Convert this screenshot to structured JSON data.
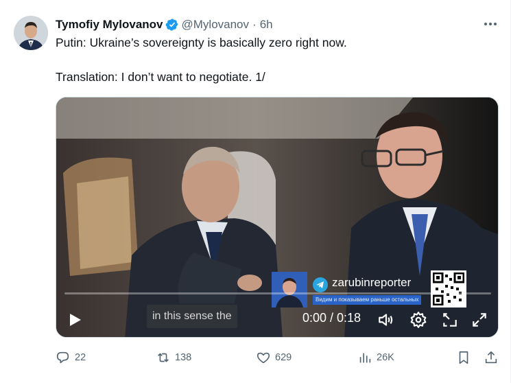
{
  "author": {
    "display_name": "Tymofiy Mylovanov",
    "handle": "@Mylovanov",
    "separator": "·",
    "time": "6h"
  },
  "tweet": {
    "line1": "Putin: Ukraine’s sovereignty is basically zero right now.",
    "line2": "Translation: I don’t want to negotiate. 1/"
  },
  "video": {
    "subtitle": "in this sense the",
    "watermark_channel": "zarubinreporter",
    "watermark_tagline": "Видим и показываем раньше остальных",
    "time": "0:00 / 0:18",
    "progress": 0
  },
  "actions": {
    "replies": "22",
    "reposts": "138",
    "likes": "629",
    "views": "26K"
  },
  "icons": {
    "verified": "verified-badge-icon",
    "more": "more-icon",
    "play": "play-icon",
    "volume": "volume-icon",
    "settings": "gear-icon",
    "popout": "popout-icon",
    "fullscreen": "fullscreen-icon",
    "reply": "reply-icon",
    "repost": "repost-icon",
    "like": "heart-icon",
    "views": "views-icon",
    "bookmark": "bookmark-icon",
    "share": "share-icon"
  },
  "colors": {
    "accent": "#1d9bf0",
    "text": "#0f1419",
    "secondary": "#536471"
  }
}
